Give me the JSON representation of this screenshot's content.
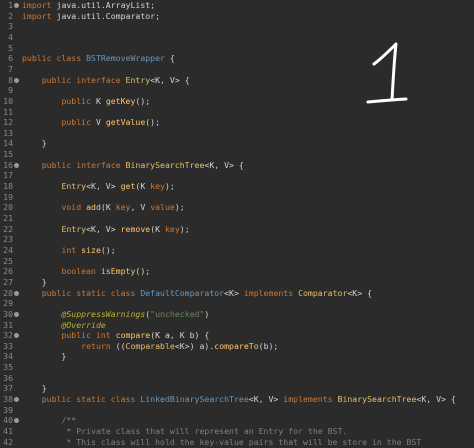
{
  "editor": {
    "lines": [
      {
        "n": "1",
        "fold": true,
        "segs": [
          [
            "kw",
            "import "
          ],
          [
            "plain",
            "java.util.ArrayList;"
          ]
        ]
      },
      {
        "n": "2",
        "segs": [
          [
            "kw",
            "import "
          ],
          [
            "plain",
            "java.util.Comparator;"
          ]
        ]
      },
      {
        "n": "3",
        "segs": []
      },
      {
        "n": "4",
        "segs": []
      },
      {
        "n": "5",
        "segs": []
      },
      {
        "n": "6",
        "segs": [
          [
            "kw",
            "public class "
          ],
          [
            "cls",
            "BSTRemoveWrapper"
          ],
          [
            "plain",
            " {"
          ]
        ]
      },
      {
        "n": "7",
        "segs": []
      },
      {
        "n": "8",
        "fold": true,
        "segs": [
          [
            "plain",
            "    "
          ],
          [
            "kw",
            "public interface "
          ],
          [
            "ty",
            "Entry"
          ],
          [
            "plain",
            "<K, V> {"
          ]
        ]
      },
      {
        "n": "9",
        "segs": []
      },
      {
        "n": "10",
        "segs": [
          [
            "plain",
            "        "
          ],
          [
            "kw",
            "public "
          ],
          [
            "plain",
            "K "
          ],
          [
            "mth",
            "getKey"
          ],
          [
            "plain",
            "();"
          ]
        ]
      },
      {
        "n": "11",
        "segs": []
      },
      {
        "n": "12",
        "segs": [
          [
            "plain",
            "        "
          ],
          [
            "kw",
            "public "
          ],
          [
            "plain",
            "V "
          ],
          [
            "mth",
            "getValue"
          ],
          [
            "plain",
            "();"
          ]
        ]
      },
      {
        "n": "13",
        "segs": []
      },
      {
        "n": "14",
        "segs": [
          [
            "plain",
            "    }"
          ]
        ]
      },
      {
        "n": "15",
        "segs": []
      },
      {
        "n": "16",
        "fold": true,
        "segs": [
          [
            "plain",
            "    "
          ],
          [
            "kw",
            "public interface "
          ],
          [
            "ty",
            "BinarySearchTree"
          ],
          [
            "plain",
            "<K, V> {"
          ]
        ]
      },
      {
        "n": "17",
        "segs": []
      },
      {
        "n": "18",
        "segs": [
          [
            "plain",
            "        "
          ],
          [
            "ty",
            "Entry"
          ],
          [
            "plain",
            "<K, V> "
          ],
          [
            "mth",
            "get"
          ],
          [
            "plain",
            "(K "
          ],
          [
            "kw",
            "key"
          ],
          [
            "plain",
            ");"
          ]
        ]
      },
      {
        "n": "19",
        "segs": []
      },
      {
        "n": "20",
        "segs": [
          [
            "plain",
            "        "
          ],
          [
            "kw",
            "void "
          ],
          [
            "mth",
            "add"
          ],
          [
            "plain",
            "(K "
          ],
          [
            "kw",
            "key"
          ],
          [
            "plain",
            ", V "
          ],
          [
            "kw",
            "value"
          ],
          [
            "plain",
            ");"
          ]
        ]
      },
      {
        "n": "21",
        "segs": []
      },
      {
        "n": "22",
        "segs": [
          [
            "plain",
            "        "
          ],
          [
            "ty",
            "Entry"
          ],
          [
            "plain",
            "<K, V> "
          ],
          [
            "mth",
            "remove"
          ],
          [
            "plain",
            "(K "
          ],
          [
            "kw",
            "key"
          ],
          [
            "plain",
            ");"
          ]
        ]
      },
      {
        "n": "23",
        "segs": []
      },
      {
        "n": "24",
        "segs": [
          [
            "plain",
            "        "
          ],
          [
            "kw",
            "int "
          ],
          [
            "mth",
            "size"
          ],
          [
            "plain",
            "();"
          ]
        ]
      },
      {
        "n": "25",
        "segs": []
      },
      {
        "n": "26",
        "segs": [
          [
            "plain",
            "        "
          ],
          [
            "kw",
            "boolean "
          ],
          [
            "mth",
            "isEmpty"
          ],
          [
            "plain",
            "();"
          ]
        ]
      },
      {
        "n": "27",
        "segs": [
          [
            "plain",
            "    }"
          ]
        ]
      },
      {
        "n": "28",
        "fold": true,
        "segs": [
          [
            "plain",
            "    "
          ],
          [
            "kw",
            "public static class "
          ],
          [
            "cls",
            "DefaultComparator"
          ],
          [
            "plain",
            "<K> "
          ],
          [
            "kw",
            "implements "
          ],
          [
            "ty",
            "Comparator"
          ],
          [
            "plain",
            "<K> {"
          ]
        ]
      },
      {
        "n": "29",
        "segs": []
      },
      {
        "n": "30",
        "fold": true,
        "segs": [
          [
            "plain",
            "        "
          ],
          [
            "ann",
            "@SuppressWarnings"
          ],
          [
            "plain",
            "("
          ],
          [
            "str",
            "\"unchecked\""
          ],
          [
            "plain",
            ")"
          ]
        ]
      },
      {
        "n": "31",
        "segs": [
          [
            "plain",
            "        "
          ],
          [
            "ann",
            "@Override"
          ]
        ]
      },
      {
        "n": "32",
        "fold": true,
        "segs": [
          [
            "plain",
            "        "
          ],
          [
            "kw",
            "public int "
          ],
          [
            "mth",
            "compare"
          ],
          [
            "plain",
            "(K a, K b) {"
          ]
        ]
      },
      {
        "n": "33",
        "segs": [
          [
            "plain",
            "            "
          ],
          [
            "kw",
            "return "
          ],
          [
            "plain",
            "(("
          ],
          [
            "ty",
            "Comparable"
          ],
          [
            "plain",
            "<K>) a)."
          ],
          [
            "mth",
            "compareTo"
          ],
          [
            "plain",
            "(b);"
          ]
        ]
      },
      {
        "n": "34",
        "segs": [
          [
            "plain",
            "        }"
          ]
        ]
      },
      {
        "n": "35",
        "segs": []
      },
      {
        "n": "36",
        "segs": []
      },
      {
        "n": "37",
        "segs": [
          [
            "plain",
            "    }"
          ]
        ]
      },
      {
        "n": "38",
        "fold": true,
        "segs": [
          [
            "plain",
            "    "
          ],
          [
            "kw",
            "public static class "
          ],
          [
            "cls",
            "LinkedBinarySearchTree"
          ],
          [
            "plain",
            "<K, V> "
          ],
          [
            "kw",
            "implements "
          ],
          [
            "ty",
            "BinarySearchTree"
          ],
          [
            "plain",
            "<K, V> {"
          ]
        ]
      },
      {
        "n": "39",
        "segs": []
      },
      {
        "n": "40",
        "fold": true,
        "segs": [
          [
            "plain",
            "        "
          ],
          [
            "cmt",
            "/**"
          ]
        ]
      },
      {
        "n": "41",
        "segs": [
          [
            "plain",
            "         "
          ],
          [
            "cmt",
            "* Private class that will represent an Entry for the BST."
          ]
        ]
      },
      {
        "n": "42",
        "segs": [
          [
            "plain",
            "         "
          ],
          [
            "cmt",
            "* This class will hold the key-value pairs that will be store in the BST"
          ]
        ]
      }
    ]
  },
  "colors": {
    "background": "#2b2b2b",
    "keyword": "#cc7832",
    "type": "#e8bf6a",
    "class_name": "#6897bb",
    "method": "#ffc66d",
    "string": "#6a8759",
    "annotation": "#bbb529",
    "comment": "#808080",
    "line_number": "#8a8a8a"
  },
  "handwritten_note": "1"
}
